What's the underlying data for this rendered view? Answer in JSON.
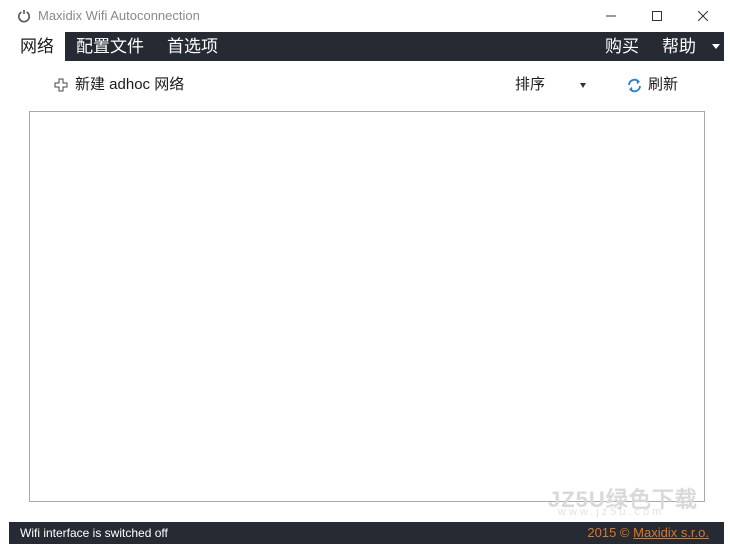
{
  "window": {
    "title": "Maxidix Wifi Autoconnection",
    "app_icon": "power-ring-icon",
    "controls": {
      "minimize": "minimize-icon",
      "maximize": "maximize-icon",
      "close": "close-icon"
    }
  },
  "menubar": {
    "items": [
      {
        "label": "网络",
        "active": true
      },
      {
        "label": "配置文件",
        "active": false
      },
      {
        "label": "首选项",
        "active": false
      }
    ],
    "right_items": [
      {
        "label": "购买"
      },
      {
        "label": "帮助"
      }
    ],
    "background": "#252a33"
  },
  "toolbar": {
    "new_adhoc_label": "新建 adhoc 网络",
    "sort_label": "排序",
    "refresh_label": "刷新"
  },
  "network_list": {
    "items": []
  },
  "watermark": {
    "line1": "JZ5U绿色下载",
    "line2": "www.jz5u.com"
  },
  "statusbar": {
    "status_text": "Wifi interface is switched off",
    "copyright_year": "2015 ©",
    "company_link": "Maxidix s.r.o.",
    "link_color": "#d9792a"
  }
}
